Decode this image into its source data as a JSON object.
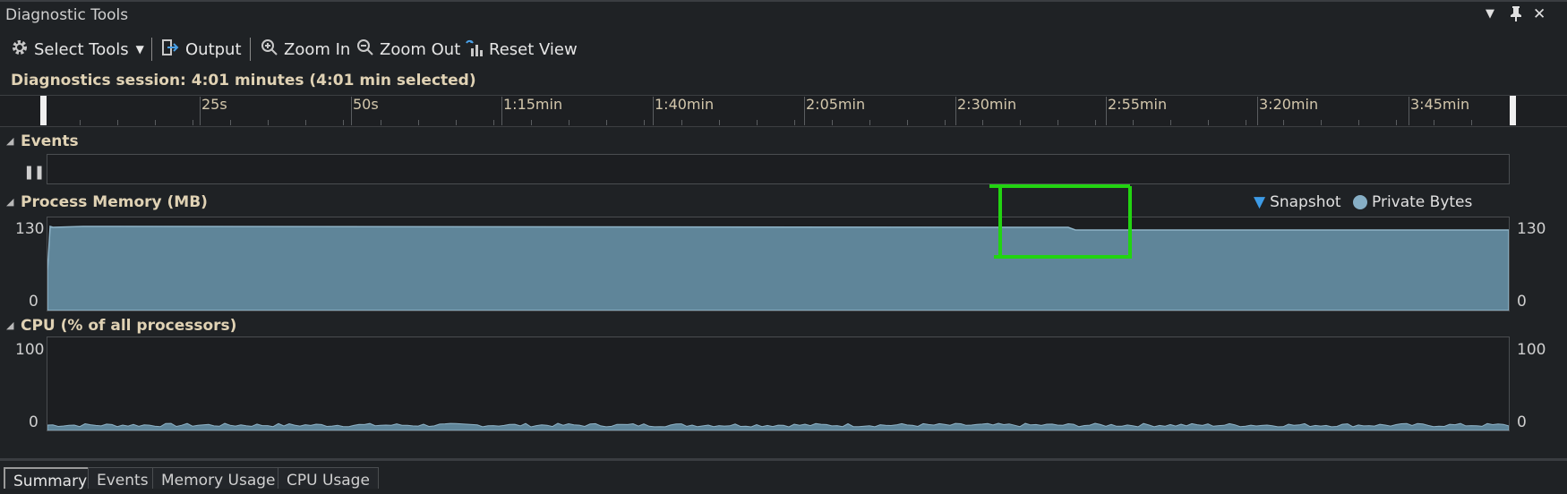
{
  "window": {
    "title": "Diagnostic Tools",
    "dropdown_glyph": "▼",
    "pin_glyph": "📌",
    "close_glyph": "✕"
  },
  "toolbar": {
    "select_tools": "Select Tools",
    "output": "Output",
    "zoom_in": "Zoom In",
    "zoom_out": "Zoom Out",
    "reset_view": "Reset View",
    "icons": [
      "gear-icon",
      "output-icon",
      "zoom-in-icon",
      "zoom-out-icon",
      "reset-view-icon"
    ]
  },
  "session": {
    "text": "Diagnostics session: 4:01 minutes (4:01 min selected)"
  },
  "ruler": {
    "ticks": [
      "25s",
      "50s",
      "1:15min",
      "1:40min",
      "2:05min",
      "2:30min",
      "2:55min",
      "3:20min",
      "3:45min"
    ]
  },
  "events": {
    "title": "Events",
    "pause_glyph": "II"
  },
  "memory": {
    "title": "Process Memory (MB)",
    "y_max": "130",
    "y_min": "0",
    "legend_snapshot": "Snapshot",
    "legend_private": "Private Bytes",
    "fill_color": "#5f8599",
    "line_color": "#8fb4c8"
  },
  "cpu": {
    "title": "CPU (% of all processors)",
    "y_max": "100",
    "y_min": "0"
  },
  "tabs": [
    "Summary",
    "Events",
    "Memory Usage",
    "CPU Usage"
  ],
  "annotation": {
    "color": "#22d411"
  }
}
